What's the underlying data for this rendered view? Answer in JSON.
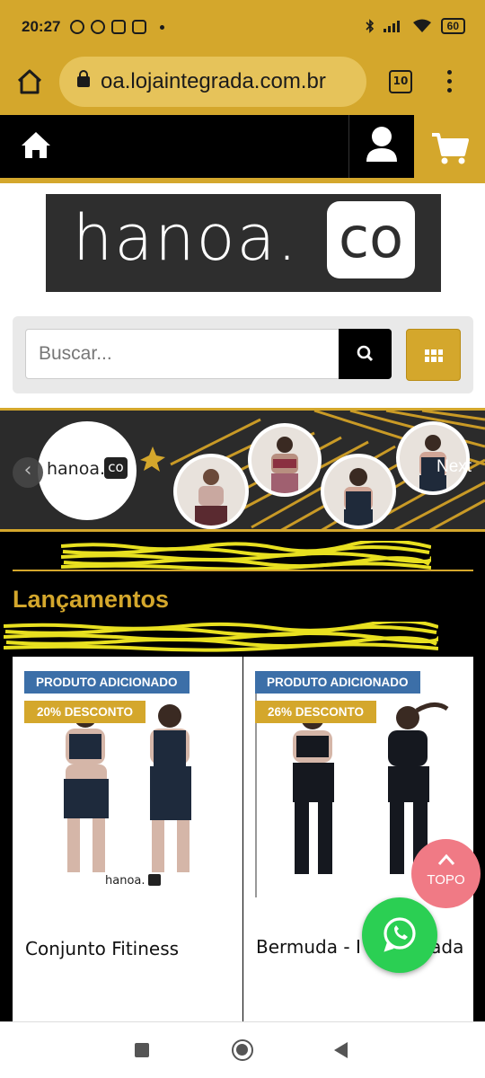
{
  "status_bar": {
    "time": "20:27",
    "battery": "60"
  },
  "browser": {
    "url": "oa.lojaintegrada.com.br",
    "tab_count": "10"
  },
  "search": {
    "placeholder": "Buscar..."
  },
  "banner": {
    "logo_text": "hanoa.",
    "logo_co": "co",
    "next_label": "Next",
    "prev_label": "‹"
  },
  "logo": {
    "text": "hanoa.",
    "co": "co"
  },
  "section": {
    "title": "Lançamentos"
  },
  "products": [
    {
      "badge_added": "PRODUTO ADICIONADO",
      "badge_discount": "20% DESCONTO",
      "name": "Conjunto Fitiness"
    },
    {
      "badge_added": "PRODUTO ADICIONADO",
      "badge_discount": "26% DESCONTO",
      "name": "Bermuda - I Camuflada"
    }
  ],
  "topo": {
    "label": "TOPO"
  },
  "colors": {
    "accent": "#d4a72c",
    "badge_blue": "#3c6fa8",
    "whatsapp": "#2bcf53",
    "topo": "#f07a85"
  }
}
